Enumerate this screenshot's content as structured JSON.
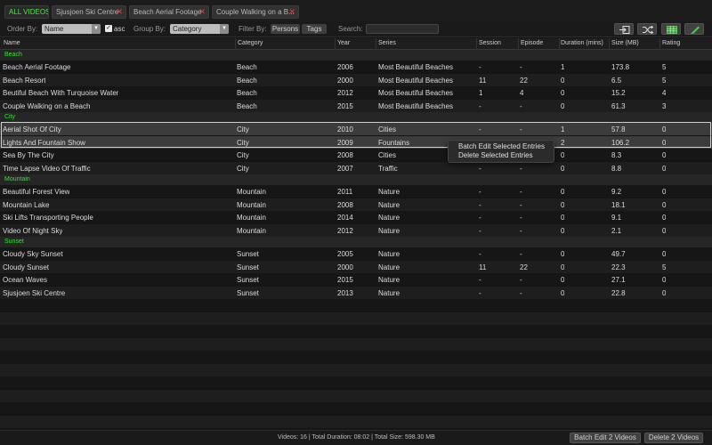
{
  "tabs": [
    {
      "label": "ALL VIDEOS",
      "active": true,
      "closable": false
    },
    {
      "label": "Sjusjoen Ski Centre",
      "active": false,
      "closable": true
    },
    {
      "label": "Beach Aerial Footage",
      "active": false,
      "closable": true
    },
    {
      "label": "Couple Walking on a B...",
      "active": false,
      "closable": true
    }
  ],
  "toolbar": {
    "order_by_label": "Order By:",
    "order_by_value": "Name",
    "asc_label": "asc",
    "asc_checked": true,
    "group_by_label": "Group By:",
    "group_by_value": "Category",
    "filter_by_label": "Filter By:",
    "persons_label": "Persons",
    "tags_label": "Tags",
    "search_label": "Search:",
    "search_value": "",
    "icons": [
      "import-icon",
      "shuffle-icon",
      "table-icon",
      "edit-pencil-icon"
    ]
  },
  "columns": [
    "Name",
    "Category",
    "Year",
    "Series",
    "Session",
    "Episode",
    "Duration (mins)",
    "Size (MB)",
    "Rating"
  ],
  "groups": [
    {
      "name": "Beach",
      "rows": [
        {
          "name": "Beach Aerial Footage",
          "category": "Beach",
          "year": "2006",
          "series": "Most Beautiful Beaches",
          "session": "-",
          "episode": "-",
          "duration": "1",
          "size": "173.8",
          "rating": "5"
        },
        {
          "name": "Beach Resort",
          "category": "Beach",
          "year": "2000",
          "series": "Most Beautiful Beaches",
          "session": "11",
          "episode": "22",
          "duration": "0",
          "size": "6.5",
          "rating": "5"
        },
        {
          "name": "Beutiful Beach With Turquoise Water",
          "category": "Beach",
          "year": "2012",
          "series": "Most Beautiful Beaches",
          "session": "1",
          "episode": "4",
          "duration": "0",
          "size": "15.2",
          "rating": "4"
        },
        {
          "name": "Couple Walking on a Beach",
          "category": "Beach",
          "year": "2015",
          "series": "Most Beautiful Beaches",
          "session": "-",
          "episode": "-",
          "duration": "0",
          "size": "61.3",
          "rating": "3"
        }
      ]
    },
    {
      "name": "City",
      "rows": [
        {
          "name": "Aerial Shot Of City",
          "category": "City",
          "year": "2010",
          "series": "Cities",
          "session": "-",
          "episode": "-",
          "duration": "1",
          "size": "57.8",
          "rating": "0",
          "selected": true
        },
        {
          "name": "Lights And Fountain Show",
          "category": "City",
          "year": "2009",
          "series": "Fountains",
          "session": "",
          "episode": "",
          "duration": "2",
          "size": "106.2",
          "rating": "0",
          "selected": true
        },
        {
          "name": "Sea By The City",
          "category": "City",
          "year": "2008",
          "series": "Cities",
          "session": "",
          "episode": "",
          "duration": "0",
          "size": "8.3",
          "rating": "0"
        },
        {
          "name": "Time Lapse Video Of Traffic",
          "category": "City",
          "year": "2007",
          "series": "Traffic",
          "session": "-",
          "episode": "-",
          "duration": "0",
          "size": "8.8",
          "rating": "0"
        }
      ]
    },
    {
      "name": "Mountain",
      "rows": [
        {
          "name": "Beautiful Forest View",
          "category": "Mountain",
          "year": "2011",
          "series": "Nature",
          "session": "-",
          "episode": "-",
          "duration": "0",
          "size": "9.2",
          "rating": "0"
        },
        {
          "name": "Mountain Lake",
          "category": "Mountain",
          "year": "2008",
          "series": "Nature",
          "session": "-",
          "episode": "-",
          "duration": "0",
          "size": "18.1",
          "rating": "0"
        },
        {
          "name": "Ski Lifts Transporting People",
          "category": "Mountain",
          "year": "2014",
          "series": "Nature",
          "session": "-",
          "episode": "-",
          "duration": "0",
          "size": "9.1",
          "rating": "0"
        },
        {
          "name": "Video Of Night Sky",
          "category": "Mountain",
          "year": "2012",
          "series": "Nature",
          "session": "-",
          "episode": "-",
          "duration": "0",
          "size": "2.1",
          "rating": "0"
        }
      ]
    },
    {
      "name": "Sunset",
      "rows": [
        {
          "name": "Cloudy Sky Sunset",
          "category": "Sunset",
          "year": "2005",
          "series": "Nature",
          "session": "-",
          "episode": "-",
          "duration": "0",
          "size": "49.7",
          "rating": "0"
        },
        {
          "name": "Cloudy Sunset",
          "category": "Sunset",
          "year": "2000",
          "series": "Nature",
          "session": "11",
          "episode": "22",
          "duration": "0",
          "size": "22.3",
          "rating": "5"
        },
        {
          "name": "Ocean Waves",
          "category": "Sunset",
          "year": "2015",
          "series": "Nature",
          "session": "-",
          "episode": "-",
          "duration": "0",
          "size": "27.1",
          "rating": "0"
        },
        {
          "name": "Sjusjoen Ski Centre",
          "category": "Sunset",
          "year": "2013",
          "series": "Nature",
          "session": "-",
          "episode": "-",
          "duration": "0",
          "size": "22.8",
          "rating": "0"
        }
      ]
    }
  ],
  "context_menu": {
    "items": [
      "Batch Edit Selected Entries",
      "Delete Selected Entries"
    ]
  },
  "status": {
    "text": "Videos:  16  |  Total Duration:  08:02  |  Total Size:  598.30 MB",
    "batch_edit_label": "Batch Edit 2 Videos",
    "delete_label": "Delete 2 Videos"
  },
  "colors": {
    "accent_green": "#38e038",
    "close_red": "#e04040",
    "background": "#141414"
  }
}
